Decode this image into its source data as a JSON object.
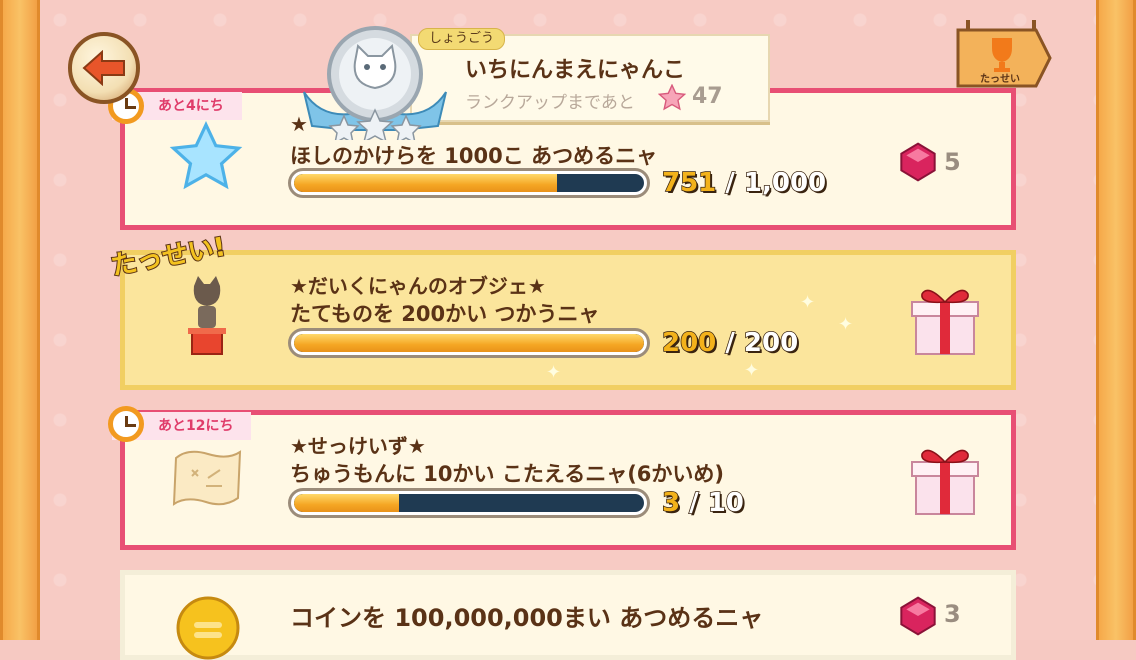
{
  "header": {
    "back_label": "back",
    "title_tag": "しょうごう",
    "title_name": "いちにんまえにゃんこ",
    "rank_up_text": "ランクアップまであと",
    "rank_up_count": "47",
    "trophy_label": "たっせい"
  },
  "missions": [
    {
      "days_left": "あと4にち",
      "title": "★",
      "description": "ほしのかけらを 1000こ あつめるニャ",
      "progress_current": "751",
      "progress_separator": "/",
      "progress_total": "1,000",
      "progress_fraction": 0.751,
      "reward_count": "5",
      "icon": "star-shard-icon",
      "reward_icon": "gem-icon"
    },
    {
      "achieved_label": "たっせい!",
      "title": "★だいくにゃんのオブジェ★",
      "description": "たてものを 200かい つかうニャ",
      "progress_current": "200",
      "progress_separator": "/",
      "progress_total": "200",
      "progress_fraction": 1.0,
      "icon": "cat-statue-icon",
      "reward_icon": "gift-box-icon"
    },
    {
      "days_left": "あと12にち",
      "title": "★せっけいず★",
      "description": "ちゅうもんに 10かい こたえるニャ(6かいめ)",
      "progress_current": "3",
      "progress_separator": "/",
      "progress_total": "10",
      "progress_fraction": 0.3,
      "icon": "blueprint-scroll-icon",
      "reward_icon": "gift-box-icon"
    },
    {
      "description": "コインを 100,000,000まい あつめるニャ",
      "reward_count": "3",
      "icon": "coin-icon",
      "reward_icon": "gem-icon"
    }
  ],
  "colors": {
    "accent_pink": "#e84f74",
    "achieved_bg": "#fbe59c",
    "bar_fill": "#f5a623",
    "bar_track": "#1f3a52"
  }
}
